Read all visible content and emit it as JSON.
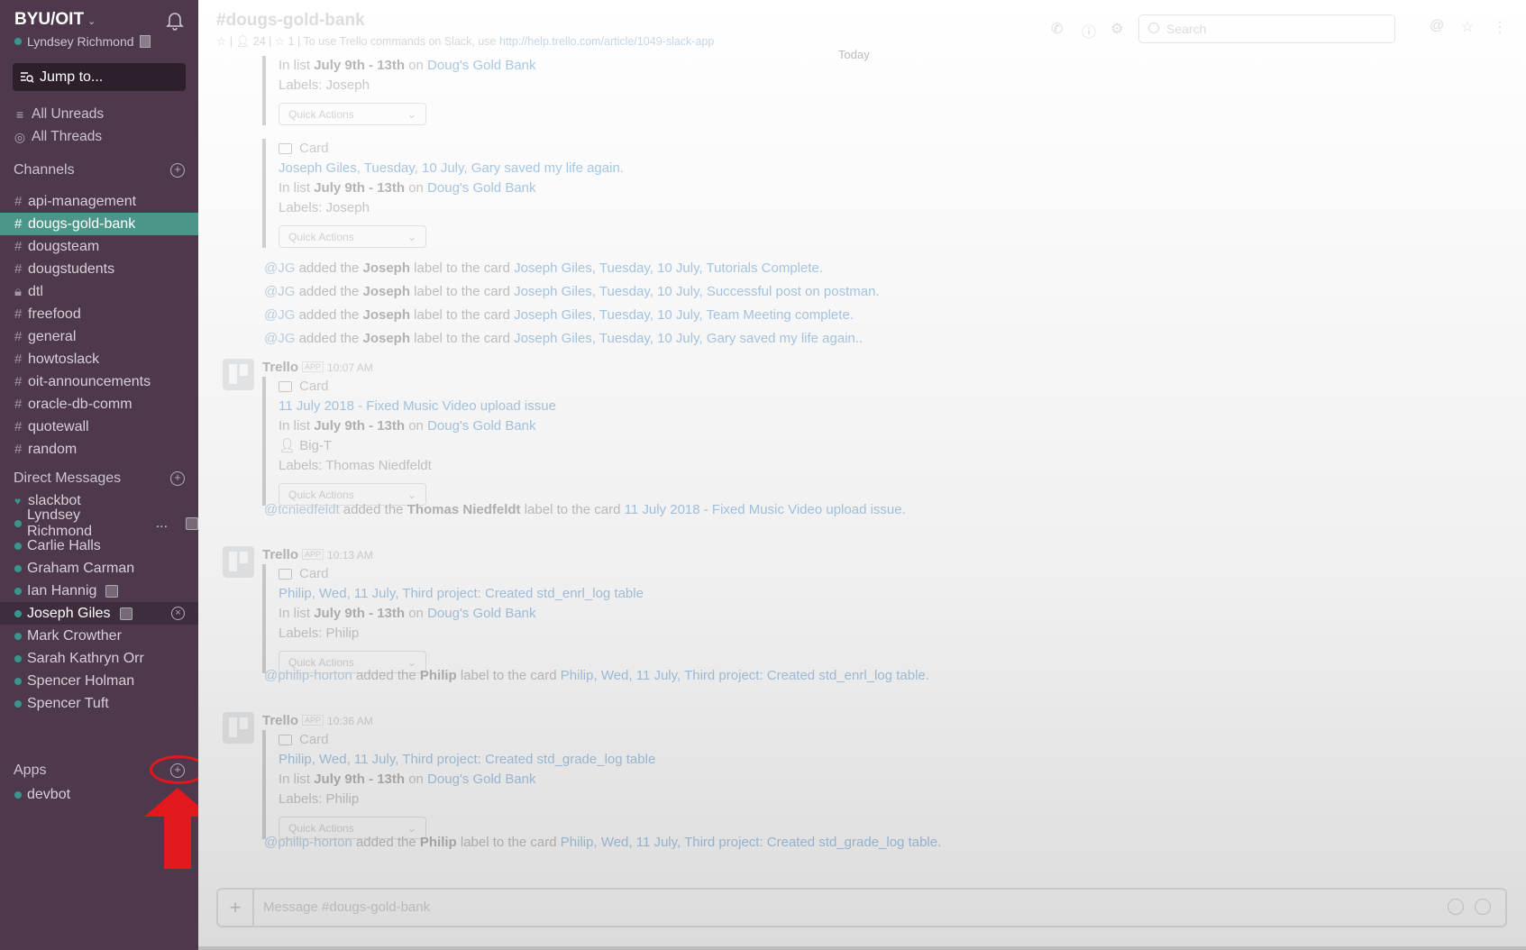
{
  "sidebar": {
    "team_name": "BYU/OIT",
    "user_name": "Lyndsey Richmond",
    "jump_label": "Jump to...",
    "nav": [
      {
        "label": "All Unreads",
        "icon": "all-unreads-icon"
      },
      {
        "label": "All Threads",
        "icon": "threads-icon"
      }
    ],
    "channels_header": "Channels",
    "channels": [
      {
        "label": "api-management",
        "private": false
      },
      {
        "label": "dougs-gold-bank",
        "private": false,
        "active": true
      },
      {
        "label": "dougsteam",
        "private": false
      },
      {
        "label": "dougstudents",
        "private": false
      },
      {
        "label": "dtl",
        "private": true
      },
      {
        "label": "freefood",
        "private": false
      },
      {
        "label": "general",
        "private": false
      },
      {
        "label": "howtoslack",
        "private": false
      },
      {
        "label": "oit-announcements",
        "private": false
      },
      {
        "label": "oracle-db-comm",
        "private": false
      },
      {
        "label": "quotewall",
        "private": false
      },
      {
        "label": "random",
        "private": false
      }
    ],
    "dm_header": "Direct Messages",
    "dms": [
      {
        "label": "slackbot"
      },
      {
        "label": "Lyndsey Richmond",
        "suffix": "..."
      },
      {
        "label": "Carlie Halls"
      },
      {
        "label": "Graham Carman"
      },
      {
        "label": "Ian Hannig"
      },
      {
        "label": "Joseph Giles"
      },
      {
        "label": "Mark Crowther"
      },
      {
        "label": "Sarah Kathryn Orr"
      },
      {
        "label": "Spencer Holman"
      },
      {
        "label": "Spencer Tuft"
      }
    ],
    "apps_header": "Apps",
    "apps": [
      {
        "label": "devbot"
      }
    ],
    "colors": {
      "bg": "#4d394b",
      "active": "#4c9689",
      "presence": "#38978d",
      "highlight": "#e3171e"
    }
  },
  "header": {
    "channel_title": "#dougs-gold-bank",
    "members": "24",
    "pins": "1",
    "topic_text": "To use Trello commands on Slack, use",
    "topic_link": "http://help.trello.com/article/1049-slack-app",
    "search_placeholder": "Search",
    "today": "Today"
  },
  "messages": {
    "att0": {
      "list_prefix": "In list",
      "list": "July 9th - 13th",
      "on": "on",
      "board": "Doug's Gold Bank",
      "labels": "Labels: Joseph",
      "quick": "Quick Actions"
    },
    "att1": {
      "card": "Card",
      "title": "Joseph Giles, Tuesday, 10 July, Gary saved my life again.",
      "list_prefix": "In list",
      "list": "July 9th - 13th",
      "on": "on",
      "board": "Doug's Gold Bank",
      "labels": "Labels: Joseph",
      "quick": "Quick Actions"
    },
    "actions1": [
      {
        "user": "@JG",
        "mid": "added the",
        "label": "Joseph",
        "mid2": "label to the card",
        "card": "Joseph Giles, Tuesday, 10 July, Tutorials Complete."
      },
      {
        "user": "@JG",
        "mid": "added the",
        "label": "Joseph",
        "mid2": "label to the card",
        "card": "Joseph Giles, Tuesday, 10 July, Successful post on postman."
      },
      {
        "user": "@JG",
        "mid": "added the",
        "label": "Joseph",
        "mid2": "label to the card",
        "card": "Joseph Giles, Tuesday, 10 July, Team Meeting complete."
      },
      {
        "user": "@JG",
        "mid": "added the",
        "label": "Joseph",
        "mid2": "label to the card",
        "card": "Joseph Giles, Tuesday, 10 July, Gary saved my life again.."
      }
    ],
    "trello1": {
      "sender": "Trello",
      "app": "APP",
      "time": "10:07 AM",
      "card": "Card",
      "title": "11 July 2018 - Fixed Music Video upload issue",
      "list_prefix": "In list",
      "list": "July 9th - 13th",
      "on": "on",
      "board": "Doug's Gold Bank",
      "member": "Big-T",
      "labels": "Labels: Thomas Niedfeldt",
      "quick": "Quick Actions"
    },
    "action2": {
      "user": "@tcniedfeldt",
      "mid": "added the",
      "label": "Thomas Niedfeldt",
      "mid2": "label to the card",
      "card": "11 July 2018 - Fixed Music Video upload issue."
    },
    "trello2": {
      "sender": "Trello",
      "app": "APP",
      "time": "10:13 AM",
      "card": "Card",
      "title": "Philip, Wed, 11 July, Third project: Created std_enrl_log table",
      "list_prefix": "In list",
      "list": "July 9th - 13th",
      "on": "on",
      "board": "Doug's Gold Bank",
      "labels": "Labels: Philip",
      "quick": "Quick Actions"
    },
    "action3": {
      "user": "@philip-horton",
      "mid": "added the",
      "label": "Philip",
      "mid2": "label to the card",
      "card": "Philip, Wed, 11 July, Third project: Created std_enrl_log table."
    },
    "trello3": {
      "sender": "Trello",
      "app": "APP",
      "time": "10:36 AM",
      "card": "Card",
      "title": "Philip, Wed, 11 July, Third project: Created std_grade_log table",
      "list_prefix": "In list",
      "list": "July 9th - 13th",
      "on": "on",
      "board": "Doug's Gold Bank",
      "labels": "Labels: Philip",
      "quick": "Quick Actions"
    },
    "action4": {
      "user": "@philip-horton",
      "mid": "added the",
      "label": "Philip",
      "mid2": "label to the card",
      "card": "Philip, Wed, 11 July, Third project: Created std_grade_log table."
    }
  },
  "composer": {
    "placeholder": "Message #dougs-gold-bank"
  }
}
